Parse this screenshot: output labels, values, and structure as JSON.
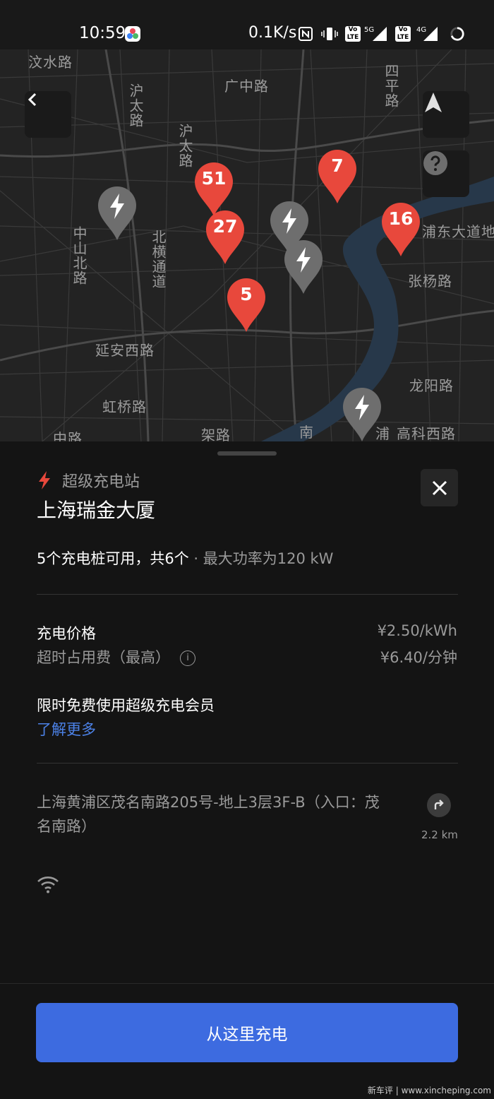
{
  "status_bar": {
    "time": "10:59",
    "network_speed": "0.1K/s",
    "volte_label": "LTE",
    "sim1_network": "5G",
    "sim2_network": "4G"
  },
  "map": {
    "road_labels": [
      "汶水路",
      "广中路",
      "四平路",
      "沪太路",
      "沪太路",
      "中山北路",
      "北横通道",
      "浦东大道地",
      "张杨路",
      "延安西路",
      "虹桥路",
      "龙阳路",
      "浦",
      "高科西路",
      "南",
      "中路",
      "架路"
    ],
    "cluster_pins": [
      "51",
      "27",
      "7",
      "16",
      "5"
    ]
  },
  "station": {
    "type_label": "超级充电站",
    "name": "上海瑞金大厦",
    "availability_main": "5个充电桩可用，共6个",
    "availability_sub": " · 最大功率为120 kW",
    "price_label": "充电价格",
    "price_value": "¥2.50/kWh",
    "idle_fee_label": "超时占用费（最高）",
    "idle_fee_info": "i",
    "idle_fee_value": "¥6.40/分钟",
    "membership_label": "限时免费使用超级充电会员",
    "learn_more": "了解更多",
    "address": "上海黄浦区茂名南路205号-地上3层3F-B（入口：茂名南路）",
    "distance": "2.2 km",
    "cta_label": "从这里充电"
  },
  "watermark": "新车评 | www.xincheping.com",
  "colors": {
    "accent_red": "#e8483c",
    "cta_blue": "#3d6be0",
    "link_blue": "#4c82e8",
    "grey_pin": "#6e6e6e"
  }
}
